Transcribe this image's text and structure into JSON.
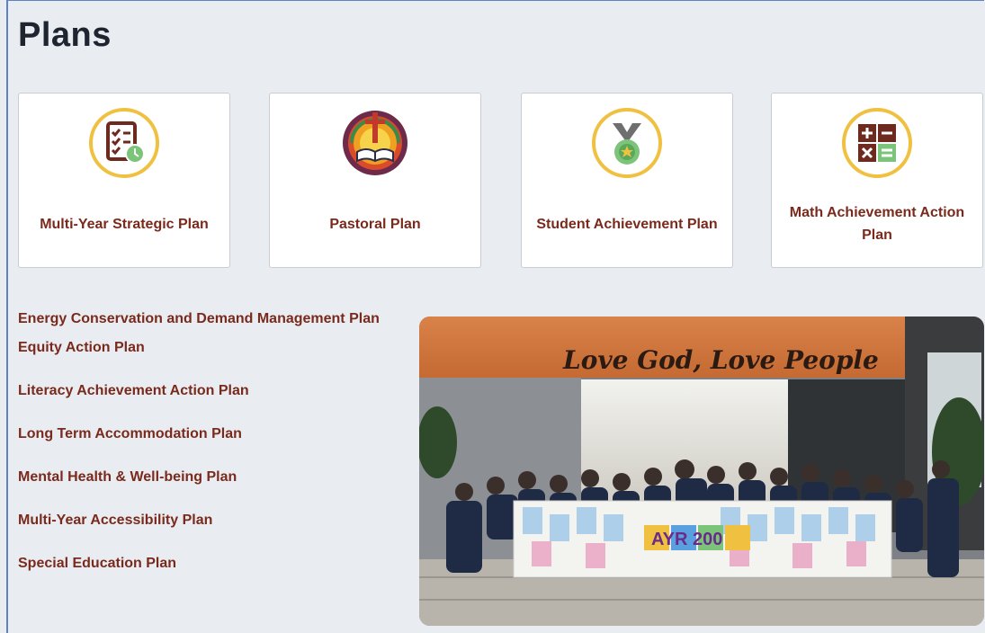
{
  "page": {
    "title": "Plans"
  },
  "cards": [
    {
      "label": "Multi-Year Strategic Plan",
      "icon": "checklist-clock-icon"
    },
    {
      "label": "Pastoral Plan",
      "icon": "cross-bible-icon"
    },
    {
      "label": "Student Achievement Plan",
      "icon": "medal-icon"
    },
    {
      "label": "Math Achievement Action Plan",
      "icon": "math-operators-icon"
    }
  ],
  "links": [
    "Energy Conservation and Demand Management Plan",
    "Equity Action Plan",
    "Literacy Achievement Action Plan",
    "Long Term Accommodation Plan",
    "Mental Health & Well-being Plan",
    "Multi-Year Accessibility Plan",
    "Special Education Plan"
  ],
  "photo": {
    "caption": "Love God, Love People",
    "banner_text": "AYR 200"
  },
  "colors": {
    "link": "#7a2a1c",
    "icon_ring": "#f0c040",
    "icon_dark": "#6e2a1e",
    "icon_green": "#7cc47a"
  }
}
